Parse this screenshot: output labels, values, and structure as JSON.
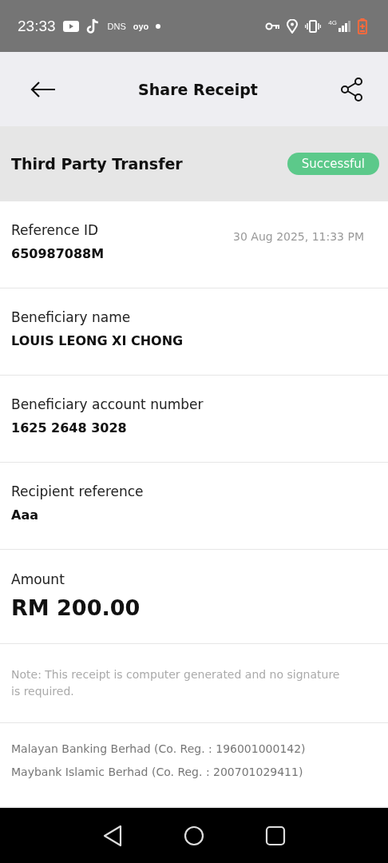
{
  "status_bar": {
    "time": "23:33",
    "dns": "DNS",
    "oyo": "oyo",
    "network": "4G"
  },
  "header": {
    "title": "Share Receipt"
  },
  "transfer": {
    "title": "Third Party Transfer",
    "status": "Successful"
  },
  "rows": [
    {
      "kind": "field",
      "label": "Reference ID",
      "value": "650987088M",
      "date": "30 Aug 2025, 11:33 PM"
    },
    {
      "kind": "field",
      "label": "Beneficiary name",
      "value": "LOUIS LEONG XI CHONG"
    },
    {
      "kind": "field",
      "label": "Beneficiary account number",
      "value": "1625 2648 3028"
    },
    {
      "kind": "field",
      "label": "Recipient reference",
      "value": "Aaa"
    },
    {
      "kind": "amount",
      "label": "Amount",
      "value": "RM 200.00"
    }
  ],
  "note": "Note: This receipt is computer generated and no signature is required.",
  "footer": [
    "Malayan Banking Berhad (Co. Reg. : 196001000142)",
    "Maybank Islamic Berhad (Co. Reg. : 200701029411)"
  ]
}
